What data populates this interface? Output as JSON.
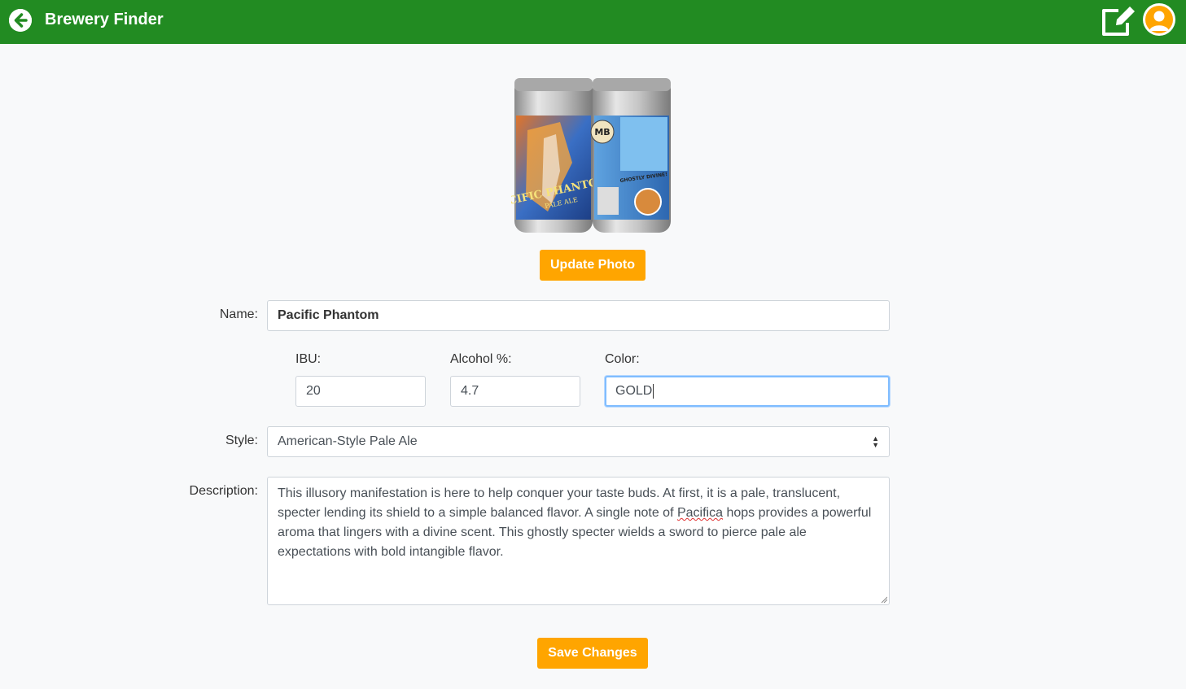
{
  "header": {
    "title": "Brewery Finder",
    "back_icon": "arrow-left-circle-icon",
    "edit_icon": "external-edit-icon",
    "profile_icon": "user-avatar-icon",
    "bg_color": "#228b22"
  },
  "photo": {
    "icon": "beer-cans-photo",
    "can_text": [
      "PACIFIC PHANTOM",
      "PALE ALE",
      "MB",
      "GHOSTLY DIVINE"
    ]
  },
  "buttons": {
    "update_photo": "Update Photo",
    "save_changes": "Save Changes",
    "accent_color": "#ffa500"
  },
  "form": {
    "name_label": "Name:",
    "name_value": "Pacific Phantom",
    "ibu_label": "IBU:",
    "ibu_value": "20",
    "alcohol_label": "Alcohol %:",
    "alcohol_value": "4.7",
    "color_label": "Color:",
    "color_value": "GOLD",
    "style_label": "Style:",
    "style_value": "American-Style Pale Ale",
    "description_label": "Description:",
    "description_part1": "This illusory manifestation is here to help conquer your taste buds. At first, it is a pale, translucent, specter lending its shield to a simple balanced flavor. A single note of ",
    "description_misspelled": "Pacifica",
    "description_part2": " hops provides a powerful aroma that lingers with a divine scent. This ghostly specter wields a sword to pierce pale ale expectations with bold intangible flavor."
  }
}
